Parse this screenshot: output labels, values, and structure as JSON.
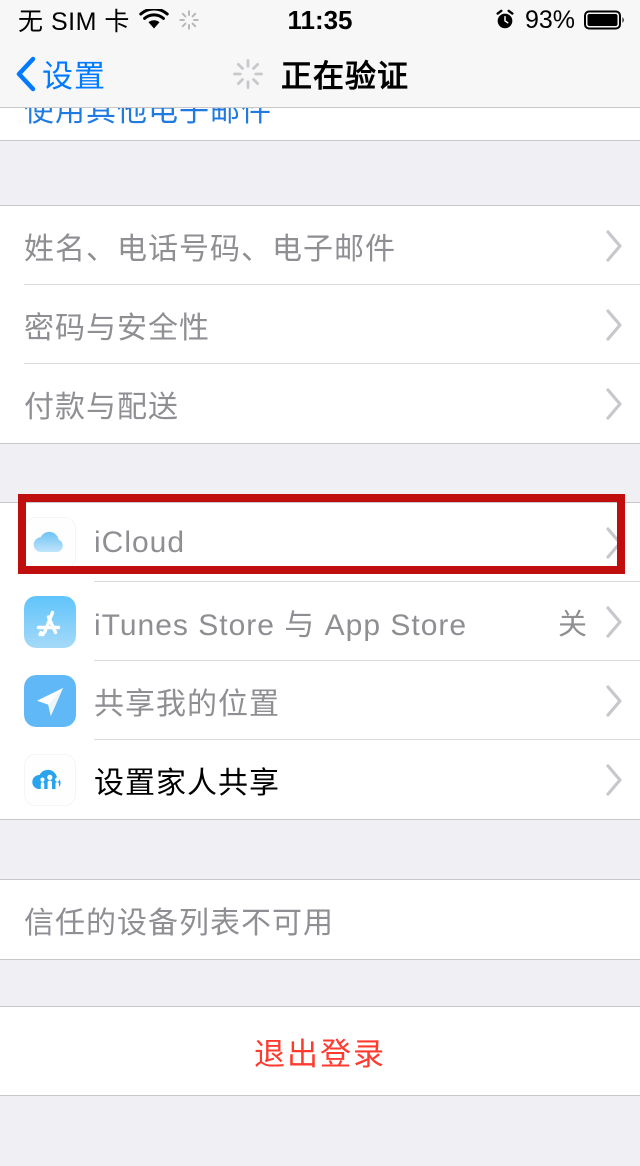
{
  "status_bar": {
    "carrier": "无 SIM 卡",
    "wifi_icon": "wifi-icon",
    "activity_icon": "activity-spinner-icon",
    "time": "11:35",
    "alarm_icon": "alarm-clock-icon",
    "battery_percent": "93%",
    "battery_icon": "battery-full-icon"
  },
  "nav_bar": {
    "back_icon": "chevron-left-icon",
    "back_label": "设置",
    "spinner_icon": "activity-spinner-icon",
    "title": "正在验证"
  },
  "partial_row": {
    "label": "使用其他电子邮件"
  },
  "sections": [
    {
      "name": "account-section",
      "rows": [
        {
          "label": "姓名、电话号码、电子邮件",
          "enabled": false,
          "chevron": true
        },
        {
          "label": "密码与安全性",
          "enabled": false,
          "chevron": true
        },
        {
          "label": "付款与配送",
          "enabled": false,
          "chevron": true
        }
      ]
    },
    {
      "name": "services-section",
      "rows": [
        {
          "label": "iCloud",
          "icon": "icloud-icon",
          "enabled": false,
          "chevron": true,
          "highlighted": true
        },
        {
          "label": "iTunes Store 与 App Store",
          "icon": "app-store-icon",
          "enabled": false,
          "chevron": true,
          "value": "关"
        },
        {
          "label": "共享我的位置",
          "icon": "location-arrow-icon",
          "enabled": false,
          "chevron": true
        },
        {
          "label": "设置家人共享",
          "icon": "family-sharing-icon",
          "enabled": true,
          "chevron": true
        }
      ]
    },
    {
      "name": "devices-section",
      "note": "信任的设备列表不可用"
    },
    {
      "name": "signout-section",
      "button_label": "退出登录"
    }
  ],
  "annotation": {
    "color": "#c00d0d",
    "target": "iCloud"
  }
}
